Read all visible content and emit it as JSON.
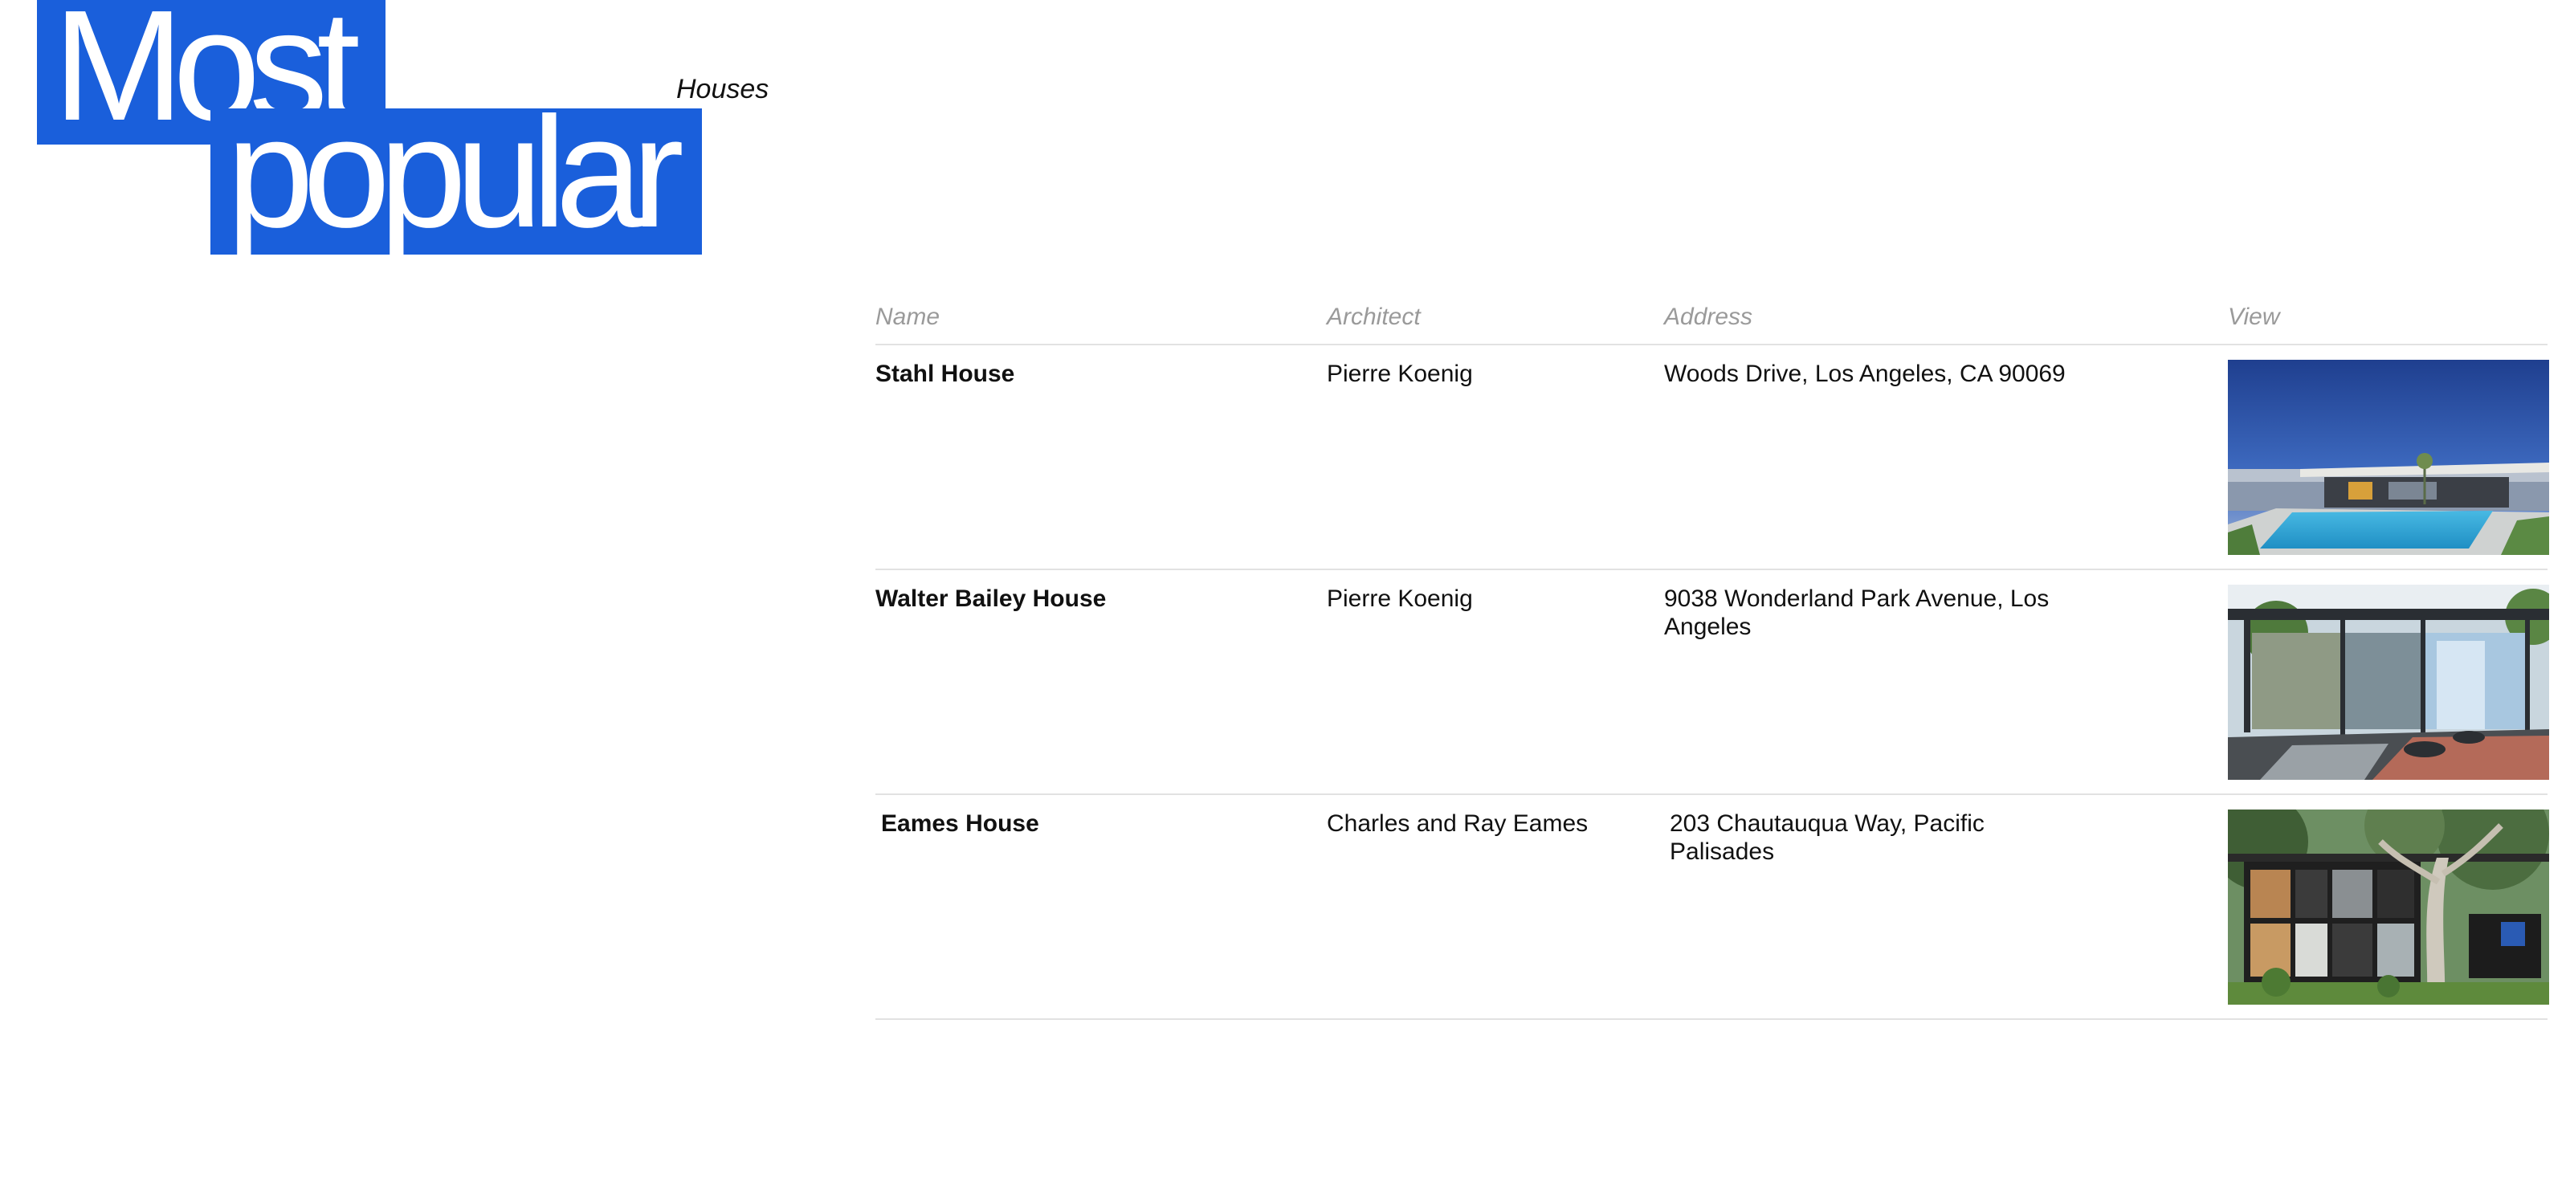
{
  "heading": {
    "line1": "Most",
    "line2": "popular",
    "subtitle": "Houses"
  },
  "colors": {
    "accent": "#1a5fdb",
    "header_text": "#9a9a9a",
    "divider": "#e2e2e2"
  },
  "table": {
    "columns": {
      "name": "Name",
      "architect": "Architect",
      "address": "Address",
      "view": "View"
    },
    "rows": [
      {
        "name": "Stahl House",
        "architect": "Pierre Koenig",
        "address": "Woods Drive, Los Angeles, CA 90069",
        "thumbnail": "house-photo-pool-overlook"
      },
      {
        "name": "Walter Bailey House",
        "architect": "Pierre Koenig",
        "address": "9038 Wonderland Park Avenue, Los Angeles",
        "thumbnail": "house-photo-glass-courtyard"
      },
      {
        "name": "Eames House",
        "architect": "Charles and Ray Eames",
        "address": "203 Chautauqua Way, Pacific Palisades",
        "thumbnail": "house-photo-eucalyptus"
      }
    ]
  }
}
